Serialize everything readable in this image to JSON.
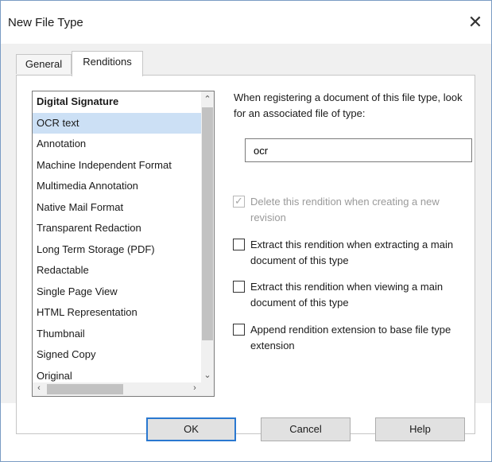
{
  "window": {
    "title": "New File Type",
    "close_glyph": "✕"
  },
  "tabs": [
    {
      "label": "General"
    },
    {
      "label": "Renditions"
    }
  ],
  "renditions_list": {
    "items": [
      {
        "label": "Digital Signature"
      },
      {
        "label": "OCR text"
      },
      {
        "label": "Annotation"
      },
      {
        "label": "Machine Independent Format"
      },
      {
        "label": "Multimedia Annotation"
      },
      {
        "label": "Native Mail Format"
      },
      {
        "label": "Transparent Redaction"
      },
      {
        "label": "Long Term Storage (PDF)"
      },
      {
        "label": "Redactable"
      },
      {
        "label": "Single Page View"
      },
      {
        "label": "HTML Representation"
      },
      {
        "label": "Thumbnail"
      },
      {
        "label": "Signed Copy"
      },
      {
        "label": "Original"
      }
    ],
    "selected": "OCR text"
  },
  "associated_file": {
    "prompt": "When registering a document of this file type, look for an associated file of type:",
    "value": "ocr"
  },
  "options": [
    {
      "label": "Delete this rendition when creating a new revision",
      "checked": true,
      "disabled": true
    },
    {
      "label": "Extract this rendition when extracting a main document of this type",
      "checked": false,
      "disabled": false
    },
    {
      "label": "Extract this rendition when viewing a main document of this type",
      "checked": false,
      "disabled": false
    },
    {
      "label": "Append rendition extension to base file type extension",
      "checked": false,
      "disabled": false
    }
  ],
  "buttons": {
    "ok": "OK",
    "cancel": "Cancel",
    "help": "Help"
  },
  "colors": {
    "selection": "#cce0f5",
    "default_button_border": "#2a78d0"
  }
}
